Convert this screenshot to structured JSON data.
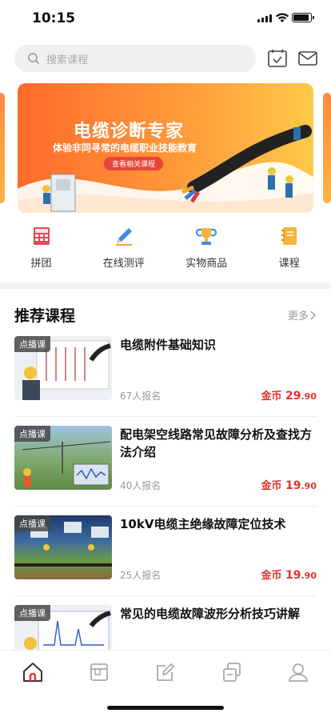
{
  "status": {
    "time": "10:15",
    "battery_fill": 0.9
  },
  "search": {
    "placeholder": "搜索课程"
  },
  "banner": {
    "title": "电缆诊断专家",
    "subtitle": "体验非同寻常的电缆职业技能教育",
    "button": "查看相关课程"
  },
  "quick_nav": [
    {
      "label": "拼团",
      "icon": "calculator-icon"
    },
    {
      "label": "在线测评",
      "icon": "pencil-icon"
    },
    {
      "label": "实物商品",
      "icon": "trophy-icon"
    },
    {
      "label": "课程",
      "icon": "notebook-icon"
    }
  ],
  "section": {
    "title": "推荐课程",
    "more": "更多"
  },
  "courses": [
    {
      "tag": "点播课",
      "name": "电缆附件基础知识",
      "enroll": "67人报名",
      "price_prefix": "金币",
      "price_int": "29",
      "price_dec": ".90"
    },
    {
      "tag": "点播课",
      "name": "配电架空线路常见故障分析及查找方法介绍",
      "enroll": "40人报名",
      "price_prefix": "金币",
      "price_int": "19",
      "price_dec": ".90"
    },
    {
      "tag": "点播课",
      "name": "10kV电缆主绝缘故障定位技术",
      "enroll": "25人报名",
      "price_prefix": "金币",
      "price_int": "19",
      "price_dec": ".90"
    },
    {
      "tag": "点播课",
      "name": "常见的电缆故障波形分析技巧讲解",
      "enroll": "",
      "price_prefix": "",
      "price_int": "",
      "price_dec": ""
    }
  ],
  "tabbar": [
    {
      "icon": "home-icon",
      "active": true
    },
    {
      "icon": "book-icon",
      "active": false
    },
    {
      "icon": "edit-icon",
      "active": false
    },
    {
      "icon": "copy-icon",
      "active": false
    },
    {
      "icon": "user-icon",
      "active": false
    }
  ],
  "colors": {
    "accent": "#e8302c",
    "banner_start": "#ff6a2a",
    "banner_end": "#ffc84a"
  }
}
